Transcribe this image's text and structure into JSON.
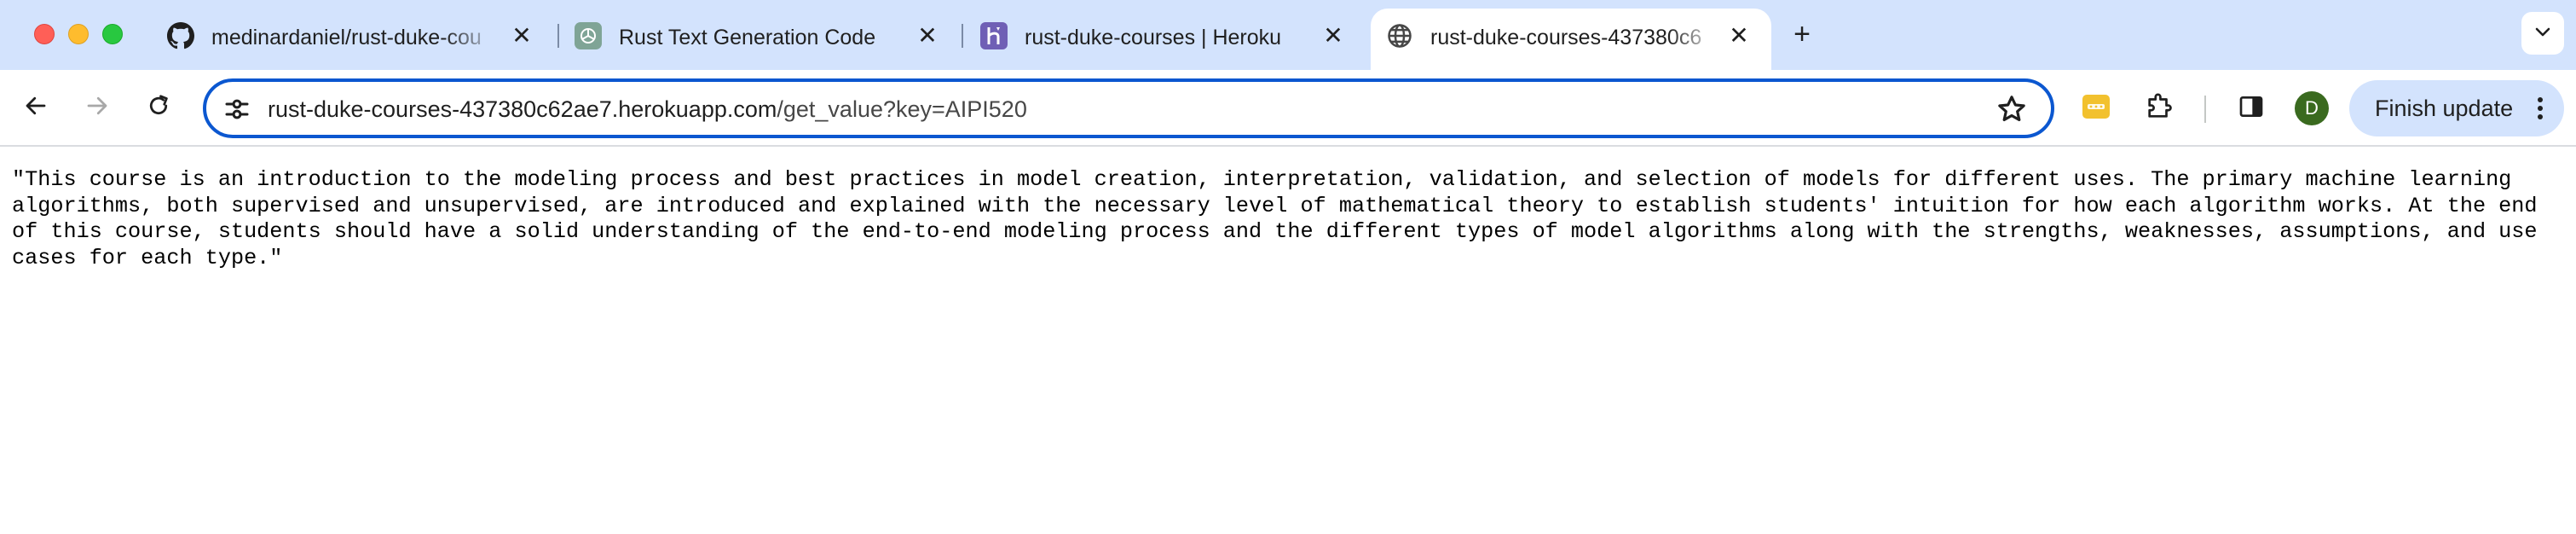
{
  "window": {
    "tabs": [
      {
        "title": "medinardaniel/rust-duke-cou",
        "favicon": "github-icon",
        "active": false
      },
      {
        "title": "Rust Text Generation Code",
        "favicon": "chatgpt-icon",
        "active": false
      },
      {
        "title": "rust-duke-courses | Heroku",
        "favicon": "heroku-icon",
        "active": false
      },
      {
        "title": "rust-duke-courses-437380c6",
        "favicon": "globe-icon",
        "active": true
      }
    ],
    "new_tab_label": "+"
  },
  "toolbar": {
    "url_host": "rust-duke-courses-437380c62ae7.herokuapp.com",
    "url_path": "/get_value?key=AIPI520",
    "avatar_initial": "D",
    "finish_update_label": "Finish update"
  },
  "page": {
    "body_text": "\"This course is an introduction to the modeling process and best practices in model creation, interpretation, validation, and selection of models for different uses. The primary machine learning algorithms, both supervised and unsupervised, are introduced and explained with the necessary level of mathematical theory to establish students' intuition for how each algorithm works. At the end of this course, students should have a solid understanding of the end-to-end modeling process and the different types of model algorithms along with the strengths, weaknesses, assumptions, and use cases for each type.\""
  },
  "colors": {
    "tabstrip_bg": "#d3e3fd",
    "omnibox_border": "#0b57d0",
    "avatar_bg": "#3a6a1f",
    "extension_pass": "#f2c12e"
  }
}
